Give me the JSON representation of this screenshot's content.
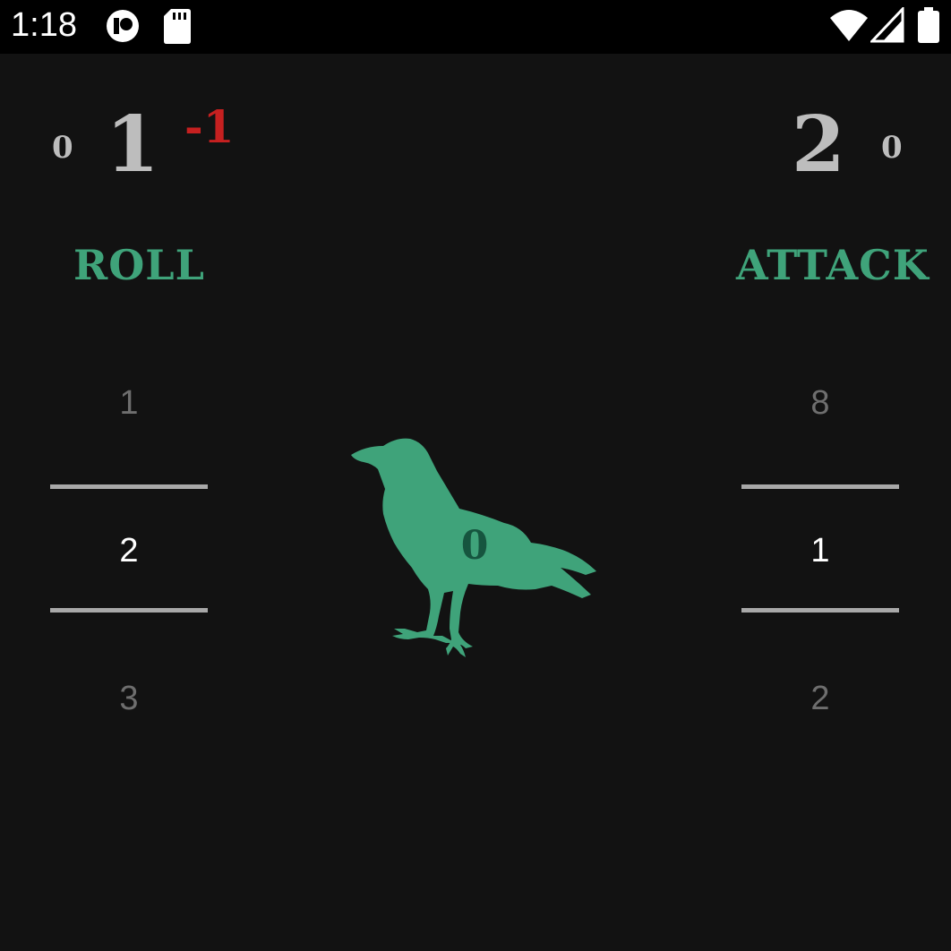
{
  "status_bar": {
    "time": "1:18",
    "left_icons": [
      "notification-circle-icon",
      "sd-card-icon"
    ],
    "right_icons": [
      "wifi-icon",
      "signal-icon",
      "battery-icon"
    ]
  },
  "colors": {
    "accent": "#3fa37a",
    "negative": "#c62020",
    "score": "#bdbdbd",
    "background": "#121212"
  },
  "left": {
    "small_score": "0",
    "big_score": "1",
    "modifier": "-1",
    "title": "ROLL",
    "picker": {
      "above": "1",
      "selected": "2",
      "below": "3"
    }
  },
  "right": {
    "big_score": "2",
    "small_score": "0",
    "title": "ATTACK",
    "picker": {
      "above": "8",
      "selected": "1",
      "below": "2"
    }
  },
  "center": {
    "icon": "crow-icon",
    "value": "0"
  }
}
